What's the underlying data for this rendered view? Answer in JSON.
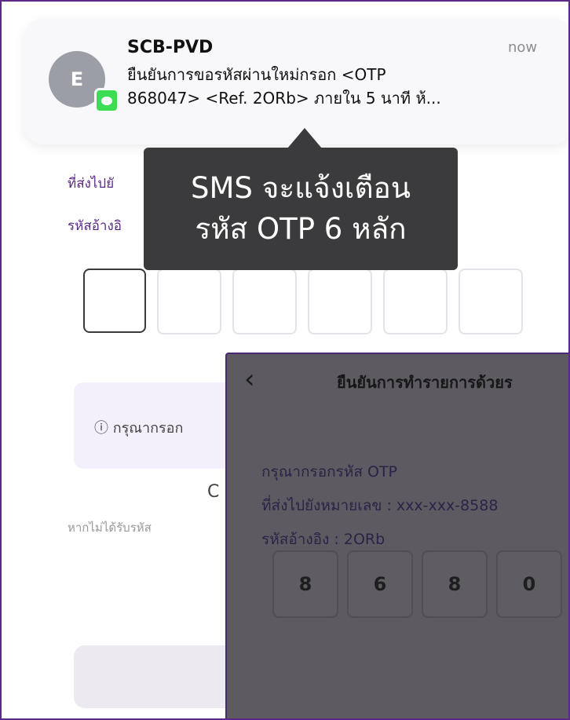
{
  "notification": {
    "sender": "SCB-PVD",
    "time": "now",
    "avatar_letter": "E",
    "app_icon": "messages-icon",
    "body_line1": "ยืนยันการขอรหัสผ่านใหม่กรอก <OTP",
    "body_line2": "868047> <Ref. 2ORb> ภายใน 5 นาที ห้..."
  },
  "tooltip": {
    "line1": "SMS จะแจ้งเตือน",
    "line2": "รหัส OTP 6 หลัก"
  },
  "background_page": {
    "sent_to_label": "ที่ส่งไปยั",
    "ref_label": "รหัสอ้างอิ",
    "info_text": "ⓘ กรุณากรอก",
    "resend_glyph": "C",
    "not_received_text": "หากไม่ได้รับรหัส"
  },
  "otp_panel": {
    "title": "ยืนยันการทำรายการด้วยร",
    "instruction": "กรุณากรอกรหัส OTP",
    "sent_to": "ที่ส่งไปยังหมายเลข : xxx-xxx-8588",
    "reference": "รหัสอ้างอิง : 2ORb",
    "digits": [
      "8",
      "6",
      "8",
      "0"
    ]
  },
  "colors": {
    "accent": "#5b2a86",
    "tooltip_bg": "#3b3b3d",
    "overlay": "#5d5b61"
  }
}
